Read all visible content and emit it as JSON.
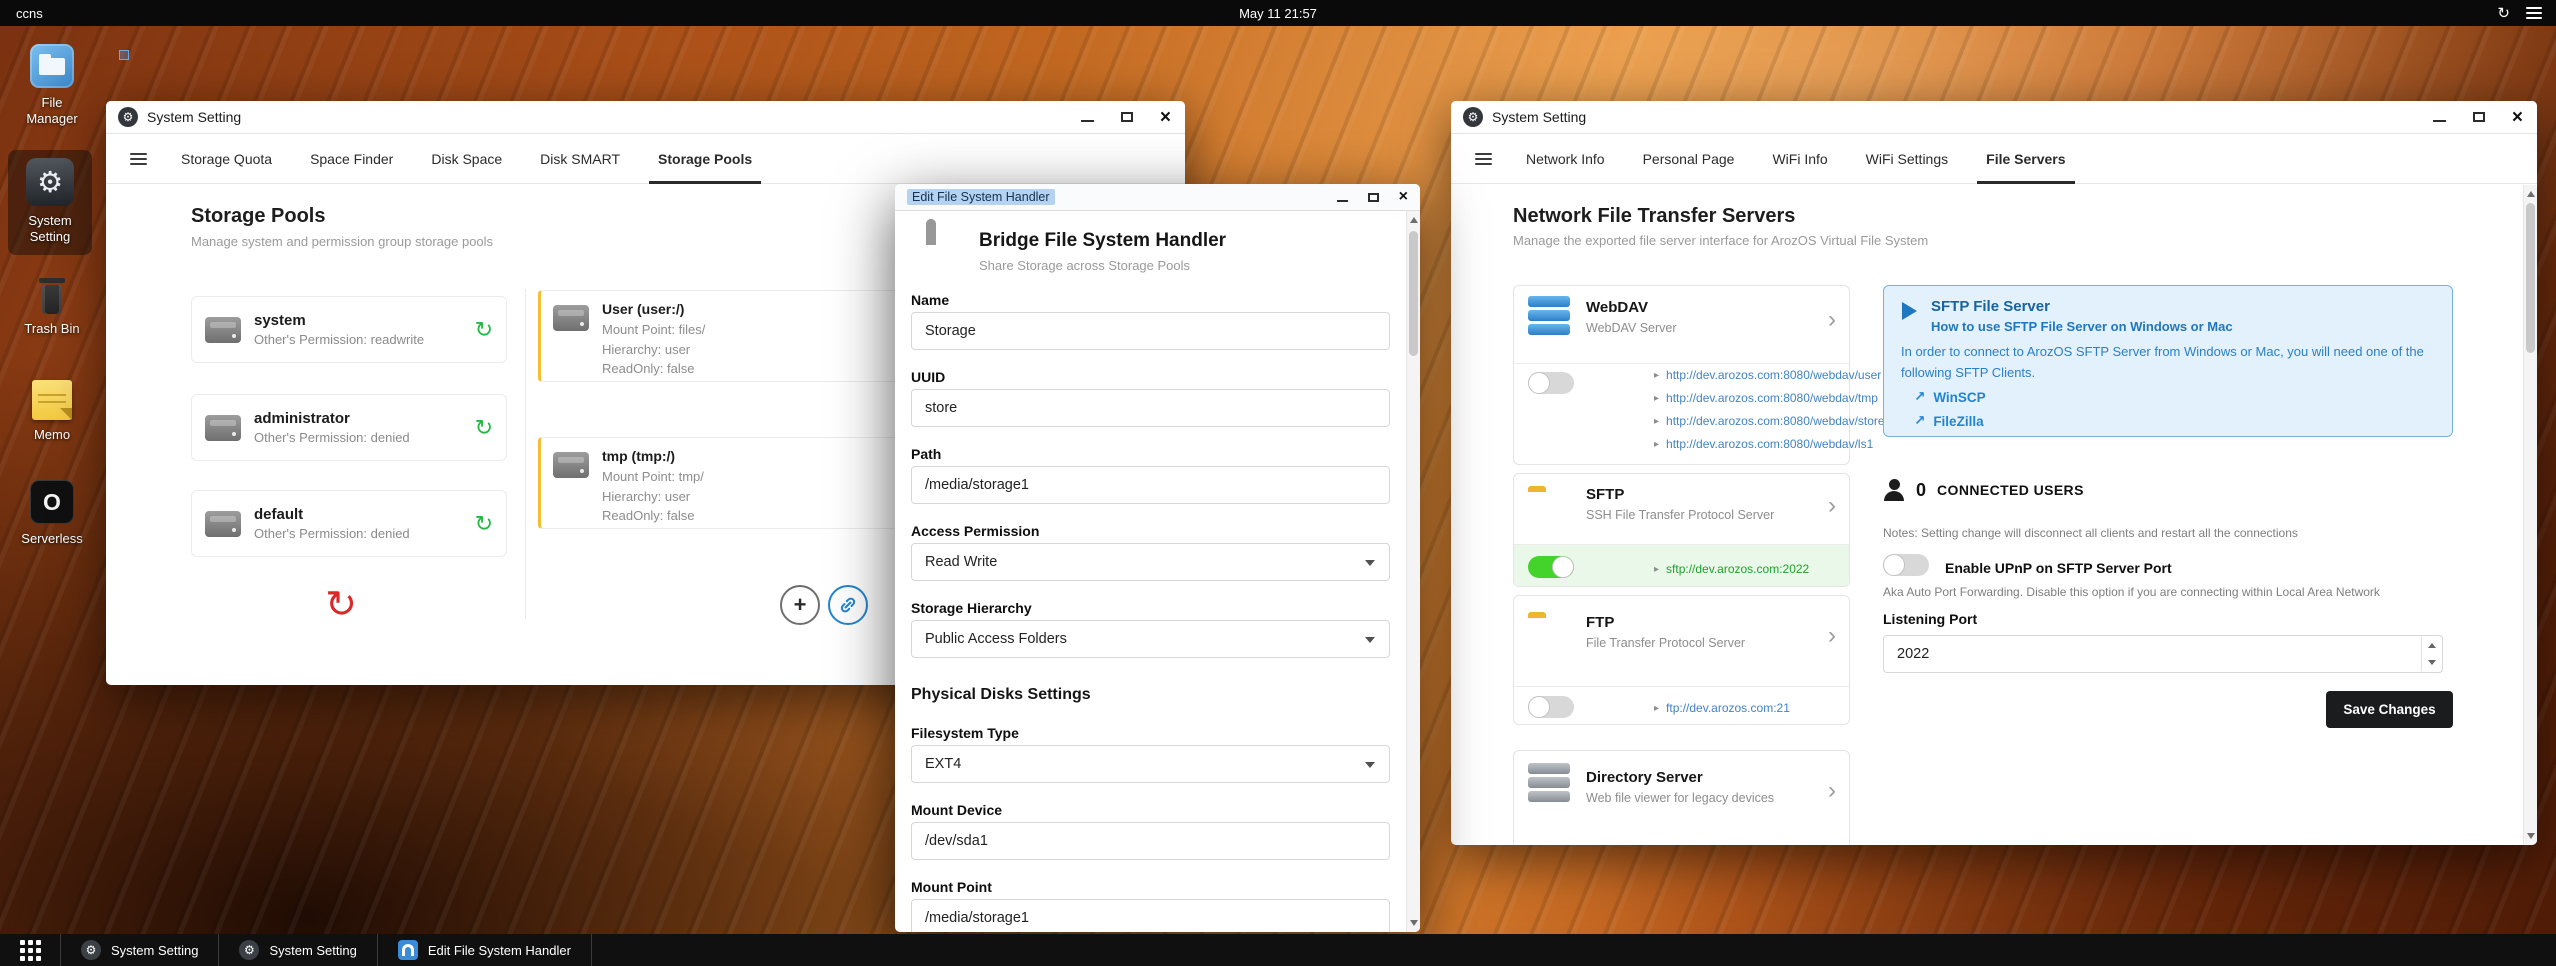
{
  "topbar": {
    "host": "ccns",
    "clock": "May 11 21:57"
  },
  "icons": {
    "gear": "⚙",
    "sync": "↻",
    "refresh": "↻",
    "close": "×",
    "plus": "+",
    "chevron": "›",
    "bullet": "▸",
    "extlink": "↗",
    "serverless": "O"
  },
  "colors": {
    "accent": "#2185d0",
    "green": "#21ba45",
    "red": "#db2828",
    "warning_border": "#f5bd31",
    "info_bg": "#e3f1fc",
    "info_border": "#74b2e2"
  },
  "desktop": {
    "items": [
      {
        "label": "File Manager"
      },
      {
        "label": "System Setting"
      },
      {
        "label": "Trash Bin"
      },
      {
        "label": "Memo"
      },
      {
        "label": "Serverless"
      }
    ]
  },
  "win_storage": {
    "title": "System Setting",
    "tabs": [
      "Storage Quota",
      "Space Finder",
      "Disk Space",
      "Disk SMART",
      "Storage Pools"
    ],
    "heading": "Storage Pools",
    "subheading": "Manage system and permission group storage pools",
    "pools": [
      {
        "name": "system",
        "desc": "Other's Permission: readwrite"
      },
      {
        "name": "administrator",
        "desc": "Other's Permission: denied"
      },
      {
        "name": "default",
        "desc": "Other's Permission: denied"
      }
    ],
    "mounts": [
      {
        "name": "User (user:/)",
        "lines": [
          "Mount Point: files/",
          "Hierarchy: user",
          "ReadOnly: false"
        ]
      },
      {
        "name": "tmp (tmp:/)",
        "lines": [
          "Mount Point: tmp/",
          "Hierarchy: user",
          "ReadOnly: false"
        ]
      }
    ]
  },
  "win_editor": {
    "title": "Edit File System Handler",
    "header": {
      "title": "Bridge File System Handler",
      "subtitle": "Share Storage across Storage Pools"
    },
    "fields": {
      "name_label": "Name",
      "name_value": "Storage",
      "uuid_label": "UUID",
      "uuid_value": "store",
      "path_label": "Path",
      "path_value": "/media/storage1",
      "access_label": "Access Permission",
      "access_value": "Read Write",
      "hierarchy_label": "Storage Hierarchy",
      "hierarchy_value": "Public Access Folders",
      "section": "Physical Disks Settings",
      "fs_label": "Filesystem Type",
      "fs_value": "EXT4",
      "device_label": "Mount Device",
      "device_value": "/dev/sda1",
      "mount_label": "Mount Point",
      "mount_value": "/media/storage1"
    }
  },
  "win_network": {
    "title": "System Setting",
    "tabs": [
      "Network Info",
      "Personal Page",
      "WiFi Info",
      "WiFi Settings",
      "File Servers"
    ],
    "heading": "Network File Transfer Servers",
    "subheading": "Manage the exported file server interface for ArozOS Virtual File System",
    "webdav": {
      "name": "WebDAV",
      "desc": "WebDAV Server",
      "links": [
        "http://dev.arozos.com:8080/webdav/user",
        "http://dev.arozos.com:8080/webdav/tmp",
        "http://dev.arozos.com:8080/webdav/store",
        "http://dev.arozos.com:8080/webdav/ls1"
      ]
    },
    "sftp": {
      "name": "SFTP",
      "desc": "SSH File Transfer Protocol Server",
      "link": "sftp://dev.arozos.com:2022"
    },
    "ftp": {
      "name": "FTP",
      "desc": "File Transfer Protocol Server",
      "link": "ftp://dev.arozos.com:21"
    },
    "dirserver": {
      "name": "Directory Server",
      "desc": "Web file viewer for legacy devices"
    },
    "info": {
      "title": "SFTP File Server",
      "subtitle": "How to use SFTP File Server on Windows or Mac",
      "body": "In order to connect to ArozOS SFTP Server from Windows or Mac, you will need one of the following SFTP Clients.",
      "clients": [
        "WinSCP",
        "FileZilla"
      ]
    },
    "connected": {
      "count": "0",
      "label": "CONNECTED USERS"
    },
    "notes": "Notes: Setting change will disconnect all clients and restart all the connections",
    "upnp": {
      "label": "Enable UPnP on SFTP Server Port",
      "desc": "Aka Auto Port Forwarding. Disable this option if you are connecting within Local Area Network"
    },
    "port": {
      "label": "Listening Port",
      "value": "2022"
    },
    "save_label": "Save Changes"
  },
  "taskbar": {
    "items": [
      {
        "label": "System Setting"
      },
      {
        "label": "System Setting"
      },
      {
        "label": "Edit File System Handler"
      }
    ]
  }
}
